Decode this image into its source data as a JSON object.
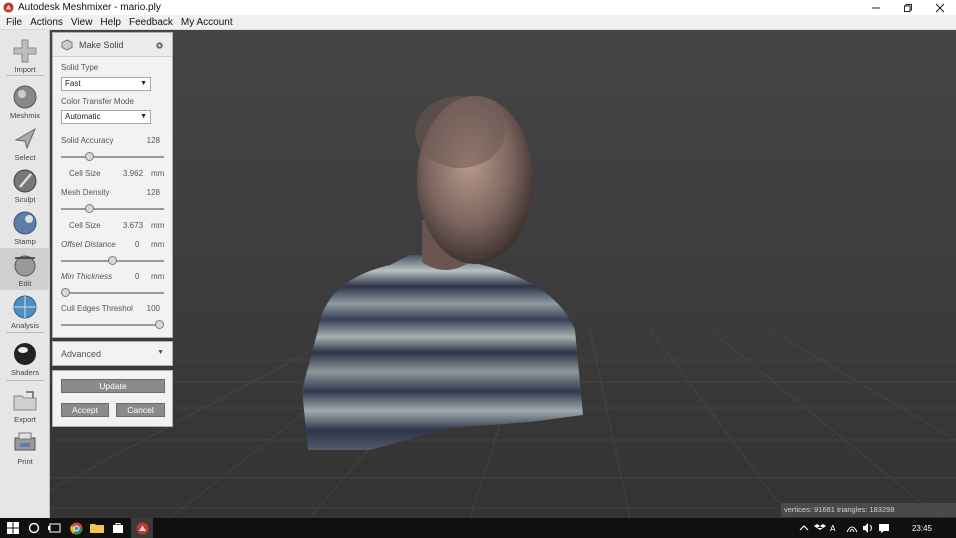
{
  "window": {
    "title": "Autodesk Meshmixer - mario.ply"
  },
  "menu": [
    "File",
    "Actions",
    "View",
    "Help",
    "Feedback",
    "My Account"
  ],
  "toolbar": [
    {
      "label": "Import",
      "icon": "plus-icon"
    },
    {
      "label": "Meshmix",
      "icon": "meshmix-sphere-icon"
    },
    {
      "label": "Select",
      "icon": "arrow-cursor-icon"
    },
    {
      "label": "Sculpt",
      "icon": "brush-icon"
    },
    {
      "label": "Stamp",
      "icon": "stamp-icon"
    },
    {
      "label": "Edit",
      "icon": "edit-sphere-icon",
      "active": true
    },
    {
      "label": "Analysis",
      "icon": "analysis-globe-icon"
    },
    {
      "label": "Shaders",
      "icon": "shader-sphere-icon"
    },
    {
      "label": "Export",
      "icon": "folder-export-icon"
    },
    {
      "label": "Print",
      "icon": "printer-icon"
    }
  ],
  "panel": {
    "title": "Make Solid",
    "solid_type_label": "Solid Type",
    "solid_type_value": "Fast",
    "color_mode_label": "Color Transfer Mode",
    "color_mode_value": "Automatic",
    "solid_accuracy_label": "Solid Accuracy",
    "solid_accuracy_value": "128",
    "solid_accuracy_slider": 0.26,
    "cell_size_label": "Cell Size",
    "cell_size_1": "3.962",
    "unit": "mm",
    "mesh_density_label": "Mesh Density",
    "mesh_density_value": "128",
    "mesh_density_slider": 0.26,
    "cell_size_2": "3.673",
    "offset_label": "Offset Distance",
    "offset_value": "0",
    "offset_slider": 0.5,
    "min_thickness_label": "Min Thickness",
    "min_thickness_value": "0",
    "min_thickness_slider": 0.0,
    "cull_label": "Cull Edges Threshol",
    "cull_value": "100",
    "cull_slider": 1.0
  },
  "advanced": {
    "label": "Advanced"
  },
  "buttons": {
    "update": "Update",
    "accept": "Accept",
    "cancel": "Cancel"
  },
  "status": {
    "text": "vertices: 91681 triangles: 183298"
  },
  "taskbar": {
    "clock": "23:45"
  },
  "colors": {
    "panel_bg": "#f2f2f2",
    "viewport_bg": "#3c3c3c",
    "button_gray": "#8a8a8a"
  }
}
